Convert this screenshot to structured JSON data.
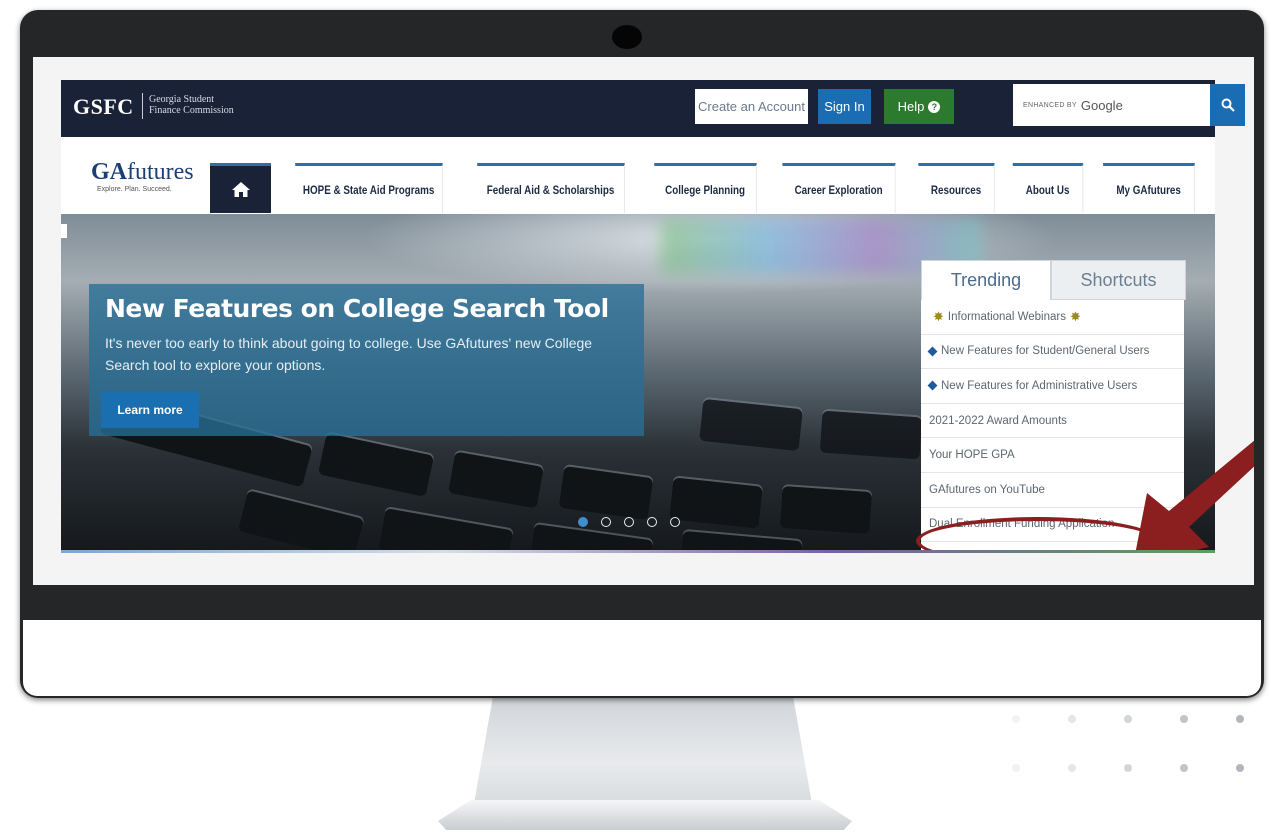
{
  "header": {
    "logo": "GSFC",
    "logo_sub_line1": "Georgia Student",
    "logo_sub_line2": "Finance Commission",
    "create_account": "Create an Account",
    "sign_in": "Sign In",
    "help": "Help",
    "search_powered": "ENHANCED BY",
    "search_brand": "Google"
  },
  "nav": {
    "brand": "GAfutures",
    "brand_tagline": "Explore. Plan. Succeed.",
    "items": [
      "HOPE & State Aid Programs",
      "Federal Aid & Scholarships",
      "College Planning",
      "Career Exploration",
      "Resources",
      "About Us",
      "My GAfutures"
    ]
  },
  "hero": {
    "title": "New Features on College Search Tool",
    "text": "It's never too early to think about going to college. Use GAfutures' new College Search tool to explore your options.",
    "button": "Learn more",
    "slide_count": 5,
    "active_slide": 1
  },
  "panel": {
    "tab_trending": "Trending",
    "tab_shortcuts": "Shortcuts",
    "items": [
      "Informational Webinars",
      "New Features for Student/General Users",
      "New Features for Administrative Users",
      "2021-2022 Award Amounts",
      "Your HOPE GPA",
      "GAfutures on YouTube",
      "Dual Enrollment Funding Application"
    ]
  },
  "colors": {
    "header_bg": "#1a2238",
    "sign_in": "#1b6db3",
    "help": "#2b7a2e",
    "highlight": "#8b1e1e"
  }
}
